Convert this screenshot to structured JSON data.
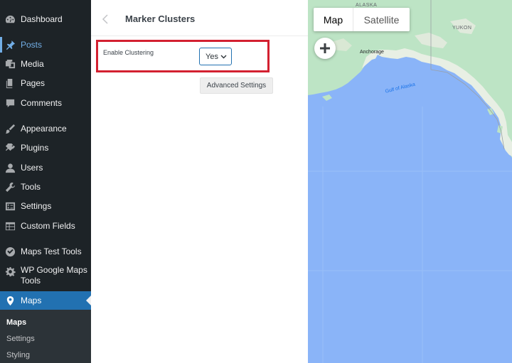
{
  "sidebar": {
    "items": [
      {
        "label": "Dashboard"
      },
      {
        "label": "Posts"
      },
      {
        "label": "Media"
      },
      {
        "label": "Pages"
      },
      {
        "label": "Comments"
      },
      {
        "label": "Appearance"
      },
      {
        "label": "Plugins"
      },
      {
        "label": "Users"
      },
      {
        "label": "Tools"
      },
      {
        "label": "Settings"
      },
      {
        "label": "Custom Fields"
      },
      {
        "label": "Maps Test Tools"
      },
      {
        "label": "WP Google Maps Tools"
      },
      {
        "label": "Maps"
      }
    ],
    "submenu": [
      {
        "label": "Maps"
      },
      {
        "label": "Settings"
      },
      {
        "label": "Styling"
      }
    ]
  },
  "panel": {
    "title": "Marker Clusters",
    "clustering_label": "Enable Clustering",
    "clustering_value": "Yes",
    "advanced_button": "Advanced Settings"
  },
  "map": {
    "type_map": "Map",
    "type_satellite": "Satellite",
    "labels": {
      "alaska": "ALASKA",
      "yukon": "YUKON",
      "anchorage": "Anchorage",
      "gulf": "Gulf of Alaska"
    }
  },
  "colors": {
    "sidebar_bg": "#1d2327",
    "active_bg": "#2271b1",
    "highlight": "#d32030",
    "water": "#8ab4f8",
    "land": "#bde4c5"
  }
}
